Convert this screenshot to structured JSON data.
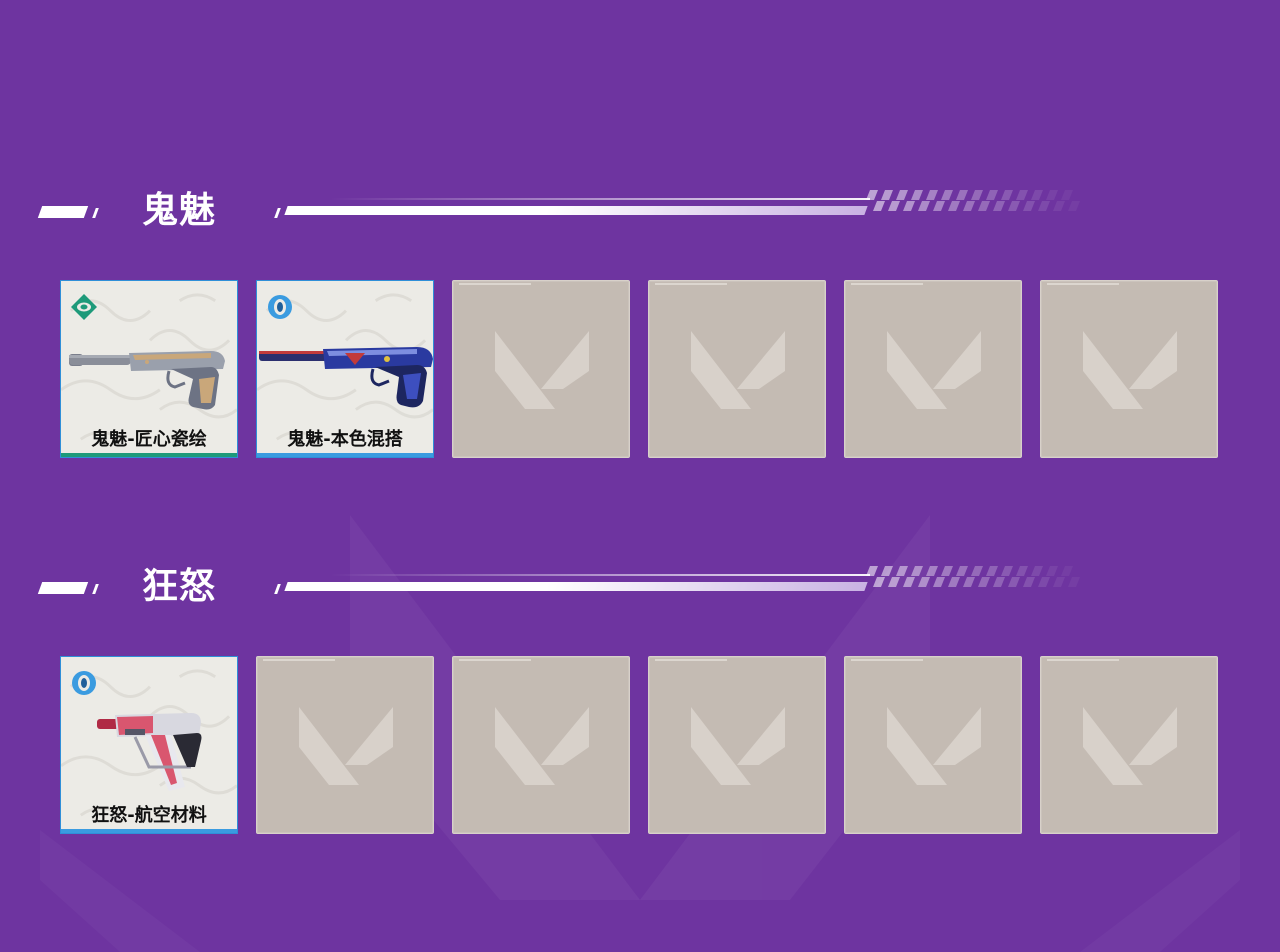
{
  "colors": {
    "background": "#6e34a0",
    "empty_slot": "#c4bbb3",
    "card_bg": "#ecebe6",
    "green_tier": "#1e9a7a",
    "blue_tier": "#3a9be0"
  },
  "sections": [
    {
      "title": "鬼魅",
      "slots": [
        {
          "name": "鬼魅-匠心瓷绘",
          "rarity_icon": "green-diamond-rarity-icon",
          "accent": "#1e9a7a",
          "weapon": "ghost-pistol-porcelain"
        },
        {
          "name": "鬼魅-本色混搭",
          "rarity_icon": "blue-ring-rarity-icon",
          "accent": "#3a9be0",
          "weapon": "ghost-pistol-blue"
        },
        {
          "empty": true
        },
        {
          "empty": true
        },
        {
          "empty": true
        },
        {
          "empty": true
        }
      ]
    },
    {
      "title": "狂怒",
      "slots": [
        {
          "name": "狂怒-航空材料",
          "rarity_icon": "blue-ring-rarity-icon",
          "accent": "#3a9be0",
          "weapon": "frenzy-pistol-aero"
        },
        {
          "empty": true
        },
        {
          "empty": true
        },
        {
          "empty": true
        },
        {
          "empty": true
        },
        {
          "empty": true
        }
      ]
    }
  ]
}
